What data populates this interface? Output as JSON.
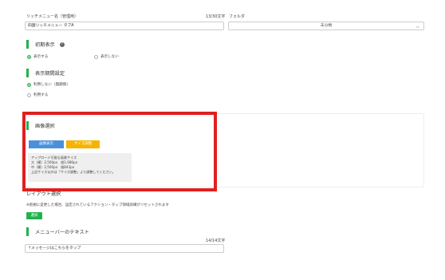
{
  "richmenu_name": {
    "label": "リッチメニュー名（管理用）",
    "count": "13/30文字",
    "value": "四国リッチメニュー タブA"
  },
  "folder": {
    "label": "フォルダ",
    "selected": "未分類"
  },
  "initial_display": {
    "title": "初期表示",
    "options": [
      "表示する",
      "表示しない"
    ],
    "selected_index": 0
  },
  "display_period": {
    "title": "表示期間設定",
    "options": [
      "利用しない（無期限）",
      "利用する"
    ],
    "selected_index": 0
  },
  "image_select": {
    "title": "画像選択",
    "image_button": "画像表示",
    "size_button": "サイズ調整",
    "info_lines": [
      "アップロード可能な画像サイズ",
      "大（横）2,500px　縦1,686px",
      "中（横）2,500px　縦843px",
      "上記サイズ以外は「サイズ調整」より調整してください。"
    ]
  },
  "layout": {
    "title": "レイアウト選択",
    "note": "※新規に変更した場合、設定されているアクション・タップ領域詳細がリセットされます",
    "select_button": "選択"
  },
  "menu_bar": {
    "title": "メニューバーのテキスト",
    "count": "14/14文字",
    "value": "↑メッセージはこちらをタップ"
  },
  "colors": {
    "accent_green": "#22b14c",
    "button_blue": "#4a90d9",
    "button_yellow": "#f5b400",
    "highlight_red": "#e0201e"
  }
}
